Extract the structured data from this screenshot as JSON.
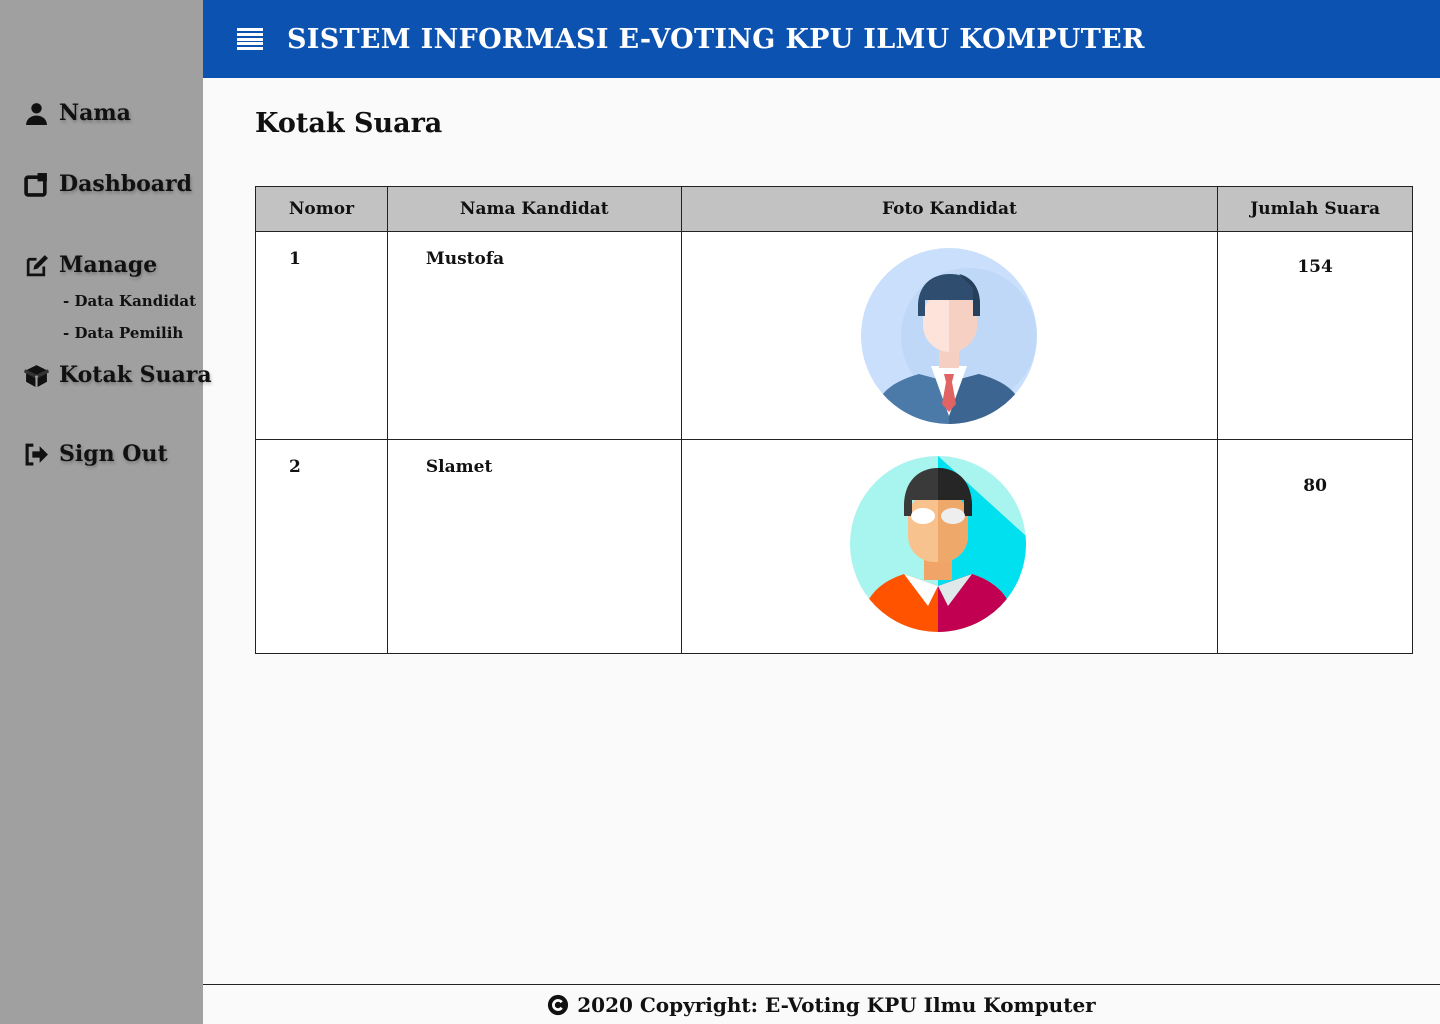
{
  "header": {
    "title": "SISTEM INFORMASI E-VOTING KPU ILMU KOMPUTER"
  },
  "sidebar": {
    "items": [
      {
        "label": "Nama",
        "icon": "user-icon"
      },
      {
        "label": "Dashboard",
        "icon": "dashboard-icon"
      },
      {
        "label": "Manage",
        "icon": "edit-icon"
      },
      {
        "label": "Kotak Suara",
        "icon": "box-icon"
      },
      {
        "label": "Sign Out",
        "icon": "sign-out-icon"
      }
    ],
    "manage_sub": [
      "- Data Kandidat",
      "- Data Pemilih"
    ]
  },
  "main": {
    "title": "Kotak Suara",
    "table": {
      "columns": [
        "Nomor",
        "Nama Kandidat",
        "Foto Kandidat",
        "Jumlah Suara"
      ],
      "rows": [
        {
          "nomor": "1",
          "nama": "Mustofa",
          "jumlah": "154",
          "photo": "businessman-avatar"
        },
        {
          "nomor": "2",
          "nama": "Slamet",
          "jumlah": "80",
          "photo": "glasses-man-avatar"
        }
      ]
    }
  },
  "footer": {
    "text": "2020 Copyright: E-Voting KPU Ilmu Komputer",
    "icon": "copyright-icon"
  },
  "colors": {
    "header": "#0c52b0",
    "sidebar": "#a0a0a0",
    "table_header": "#c2c2c2"
  }
}
